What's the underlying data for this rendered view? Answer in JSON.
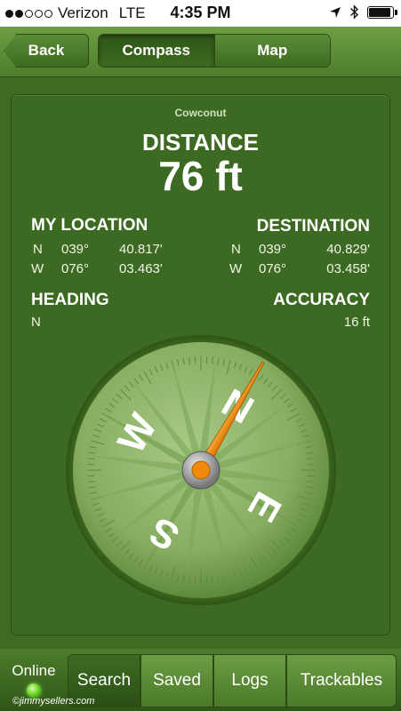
{
  "status_bar": {
    "carrier": "Verizon",
    "network": "LTE",
    "time": "4:35 PM",
    "signal_bars_filled": 2,
    "signal_bars_total": 5,
    "icons": [
      "location-arrow-icon",
      "bluetooth-icon",
      "battery-icon"
    ],
    "battery_level": 0.95
  },
  "nav": {
    "back_label": "Back",
    "segments": [
      "Compass",
      "Map"
    ],
    "active_segment": "Compass"
  },
  "cache": {
    "name": "Cowconut",
    "distance_label": "DISTANCE",
    "distance_value": "76 ft"
  },
  "my_location": {
    "title": "MY LOCATION",
    "lat": {
      "dir": "N",
      "deg": "039°",
      "min": "40.817'"
    },
    "lon": {
      "dir": "W",
      "deg": "076°",
      "min": "03.463'"
    }
  },
  "destination": {
    "title": "DESTINATION",
    "lat": {
      "dir": "N",
      "deg": "039°",
      "min": "40.829'"
    },
    "lon": {
      "dir": "W",
      "deg": "076°",
      "min": "03.458'"
    }
  },
  "heading": {
    "title": "HEADING",
    "value": "N"
  },
  "accuracy": {
    "title": "ACCURACY",
    "value": "16 ft"
  },
  "compass": {
    "letters": {
      "n": "N",
      "e": "E",
      "s": "S",
      "w": "W"
    },
    "needle_bearing_deg": 30,
    "accent_color": "#f08a0c"
  },
  "tabbar": {
    "online_label": "Online",
    "online_status_color": "#5fcd22",
    "tabs": [
      "Search",
      "Saved",
      "Logs",
      "Trackables"
    ],
    "active_tab": "Search"
  },
  "watermark": "©jimmysellers.com",
  "colors": {
    "background": "#3f6a22",
    "card": "#3d6a22",
    "compass_face": "#8fb56a"
  }
}
